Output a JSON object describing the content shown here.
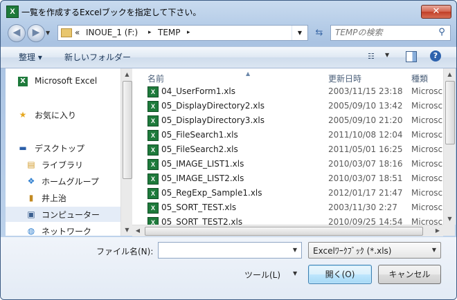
{
  "window": {
    "title": "一覧を作成するExcelブックを指定して下さい。",
    "close_label": "✕",
    "app_icon": "X"
  },
  "address": {
    "prefix": "«",
    "segments": [
      "INOUE_1 (F:)",
      "TEMP"
    ],
    "separator": "▸",
    "search_placeholder": "TEMPの検索"
  },
  "toolbar": {
    "organize_label": "整理 ▾",
    "new_folder_label": "新しいフォルダー",
    "help_label": "?"
  },
  "nav": {
    "items": [
      {
        "label": "Microsoft Excel",
        "icon": "excel-icon",
        "glyph": "X"
      },
      {
        "label": "お気に入り",
        "icon": "star-icon",
        "glyph": "★"
      },
      {
        "label": "デスクトップ",
        "icon": "desktop-icon",
        "glyph": "▬"
      },
      {
        "label": "ライブラリ",
        "icon": "library-icon",
        "glyph": "▤"
      },
      {
        "label": "ホームグループ",
        "icon": "homegroup-icon",
        "glyph": "❖"
      },
      {
        "label": "井上治",
        "icon": "user-folder-icon",
        "glyph": "▮"
      },
      {
        "label": "コンピューター",
        "icon": "computer-icon",
        "glyph": "▣"
      },
      {
        "label": "ネットワーク",
        "icon": "network-icon",
        "glyph": "◍"
      }
    ]
  },
  "columns": {
    "name": "名前",
    "date": "更新日時",
    "type": "種類"
  },
  "files": [
    {
      "name": "04_UserForm1.xls",
      "date": "2003/11/15 23:18",
      "type": "Microsc"
    },
    {
      "name": "05_DisplayDirectory2.xls",
      "date": "2005/09/10 13:42",
      "type": "Microsc"
    },
    {
      "name": "05_DisplayDirectory3.xls",
      "date": "2005/09/10 21:20",
      "type": "Microsc"
    },
    {
      "name": "05_FileSearch1.xls",
      "date": "2011/10/08 12:04",
      "type": "Microsc"
    },
    {
      "name": "05_FileSearch2.xls",
      "date": "2011/05/01 16:25",
      "type": "Microsc"
    },
    {
      "name": "05_IMAGE_LIST1.xls",
      "date": "2010/03/07 18:16",
      "type": "Microsc"
    },
    {
      "name": "05_IMAGE_LIST2.xls",
      "date": "2010/03/07 18:51",
      "type": "Microsc"
    },
    {
      "name": "05_RegExp_Sample1.xls",
      "date": "2012/01/17 21:47",
      "type": "Microsc"
    },
    {
      "name": "05_SORT_TEST.xls",
      "date": "2003/11/30 2:27",
      "type": "Microsc"
    },
    {
      "name": "05_SORT_TEST2.xls",
      "date": "2010/09/25 14:54",
      "type": "Microsc"
    }
  ],
  "footer": {
    "filename_label": "ファイル名(N):",
    "filename_value": "",
    "filter_value": "Excelﾜｰｸﾌﾞｯｸ (*.xls)",
    "tools_label": "ツール(L)",
    "open_label": "開く(O)",
    "cancel_label": "キャンセル"
  }
}
